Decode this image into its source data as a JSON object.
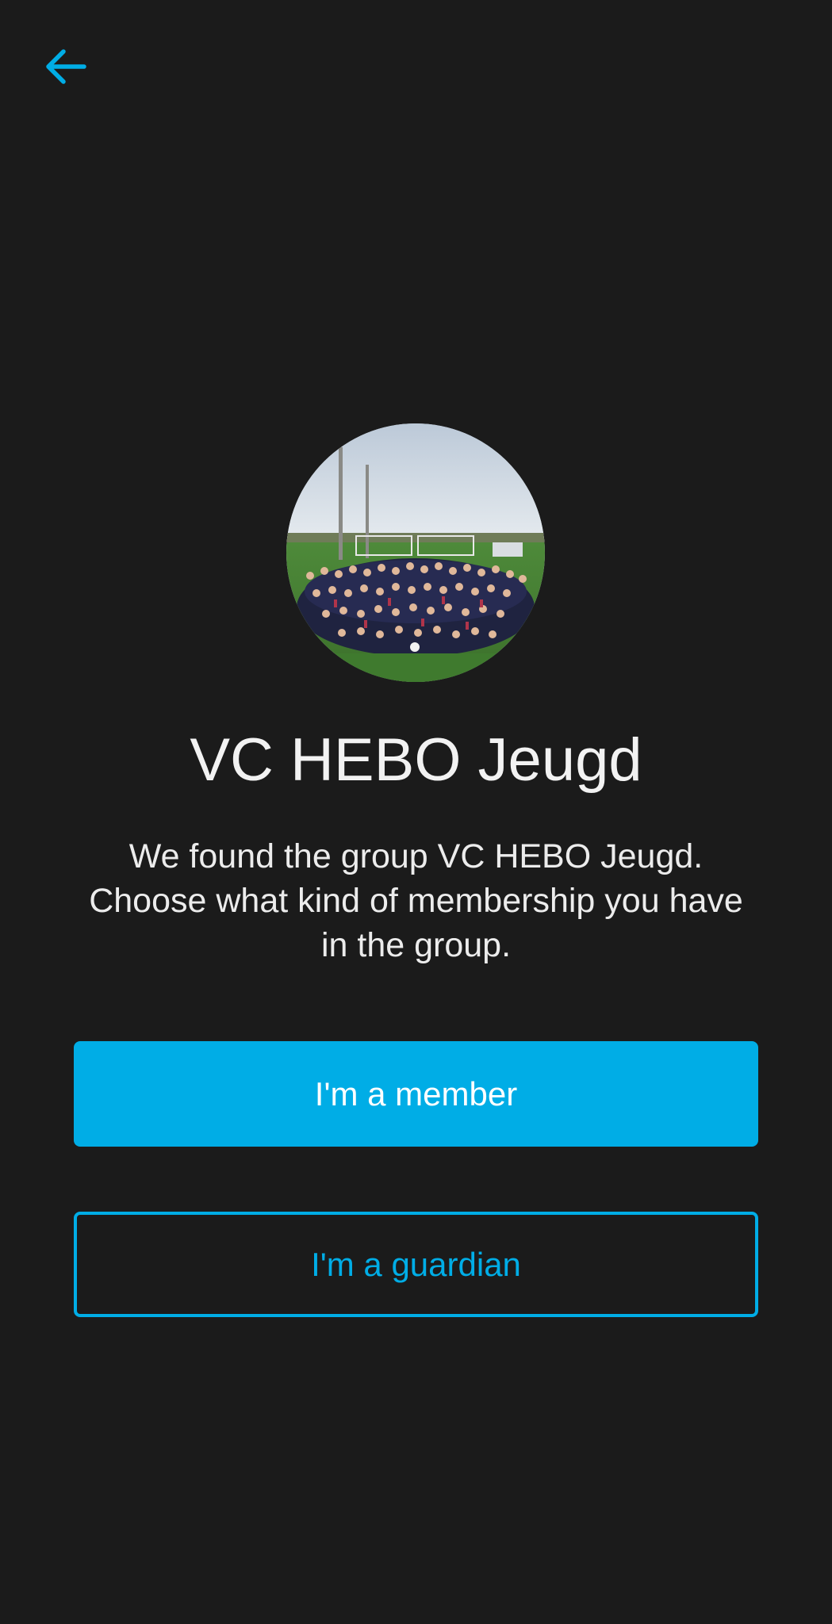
{
  "header": {
    "back_icon": "arrow-left-icon",
    "accent_color": "#00ade6"
  },
  "group": {
    "name": "VC HEBO Jeugd",
    "photo_icon": "group-photo",
    "description": "We found the group VC HEBO Jeugd. Choose what kind of membership you have in the group."
  },
  "actions": {
    "member_label": "I'm a member",
    "guardian_label": "I'm a guardian"
  },
  "colors": {
    "background": "#1b1b1b",
    "primary": "#00ade6",
    "text": "#f2f2f2"
  }
}
